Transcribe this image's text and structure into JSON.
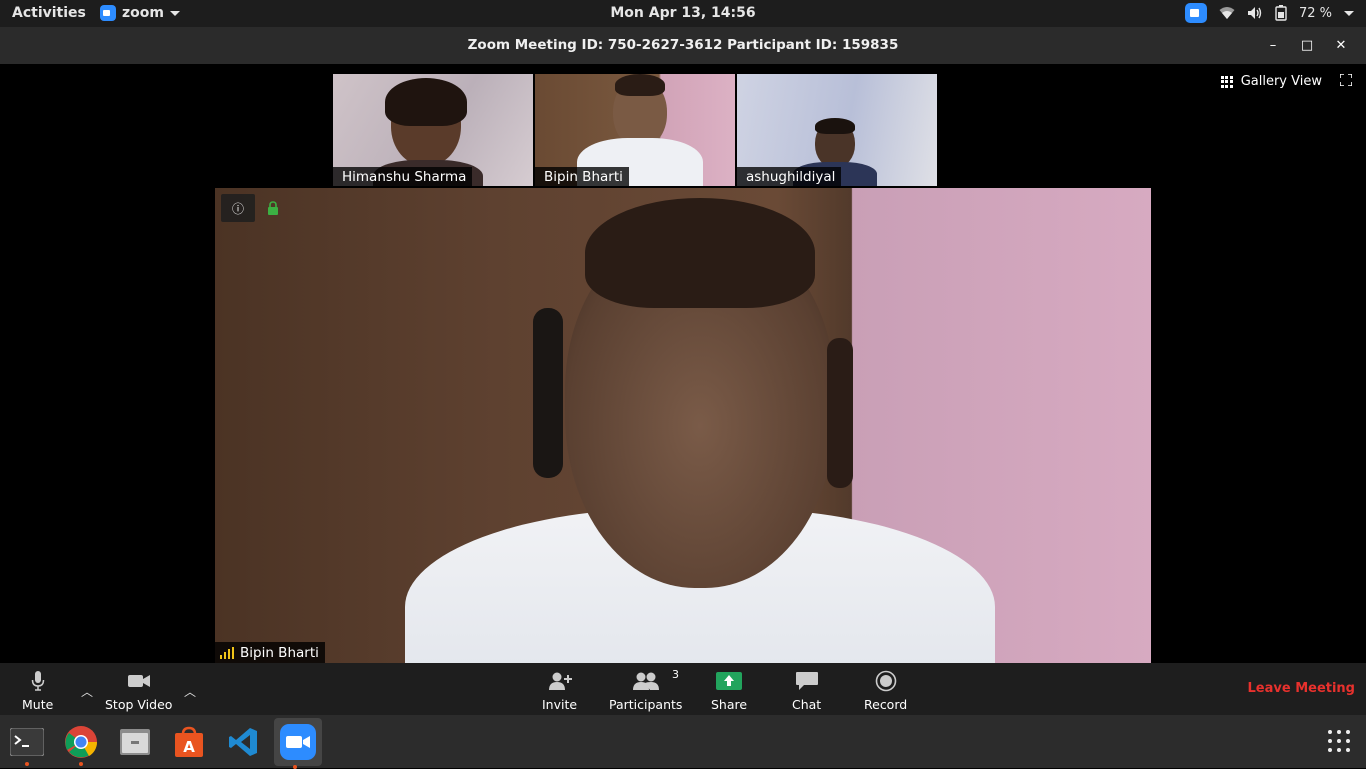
{
  "topbar": {
    "activities": "Activities",
    "app_name": "zoom",
    "clock": "Mon Apr 13, 14:56",
    "battery": "72 %"
  },
  "window": {
    "title": "Zoom Meeting ID: 750-2627-3612 Participant ID: 159835",
    "minimize": "–",
    "maximize": "□",
    "close": "✕"
  },
  "stage": {
    "view_button": "Gallery View",
    "thumbnails": [
      {
        "name": "Himanshu Sharma"
      },
      {
        "name": "Bipin Bharti"
      },
      {
        "name": "ashughildiyal"
      }
    ],
    "main_speaker": "Bipin Bharti",
    "info_icon": "ⓘ"
  },
  "toolbar": {
    "mute": "Mute",
    "stop_video": "Stop Video",
    "invite": "Invite",
    "participants": "Participants",
    "participant_count": "3",
    "share": "Share",
    "chat": "Chat",
    "record": "Record",
    "leave": "Leave Meeting"
  },
  "dock": {
    "apps": [
      "terminal-icon",
      "chrome-icon",
      "files-icon",
      "software-center-icon",
      "vscode-icon",
      "zoom-icon"
    ]
  },
  "colors": {
    "active_thumb": "#7cc34a",
    "leave": "#e8312d",
    "share": "#22a45d",
    "zoom_blue": "#2d8cff"
  }
}
